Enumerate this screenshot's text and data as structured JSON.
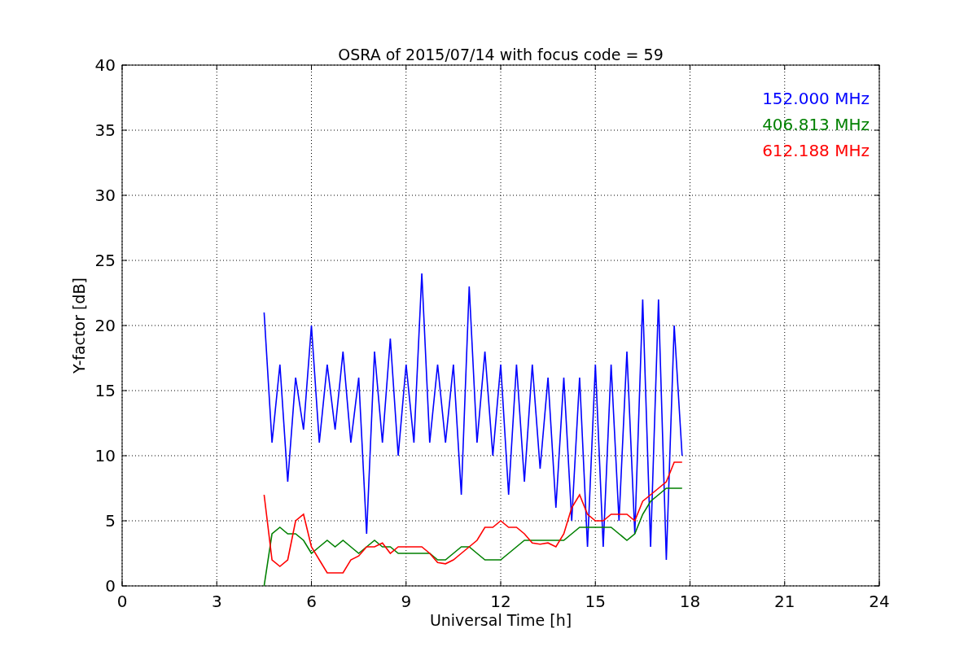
{
  "figure": {
    "chart_data": {
      "type": "line",
      "title": "OSRA of 2015/07/14 with focus code = 59",
      "xlabel": "Universal Time [h]",
      "ylabel": "Y-factor [dB]",
      "x": [
        4.5,
        4.75,
        5,
        5.25,
        5.5,
        5.75,
        6,
        6.25,
        6.5,
        6.75,
        7,
        7.25,
        7.5,
        7.75,
        8,
        8.25,
        8.5,
        8.75,
        9,
        9.25,
        9.5,
        9.75,
        10,
        10.25,
        10.5,
        10.75,
        11,
        11.25,
        11.5,
        11.75,
        12,
        12.25,
        12.5,
        12.75,
        13,
        13.25,
        13.5,
        13.75,
        14,
        14.25,
        14.5,
        14.75,
        15,
        15.25,
        15.5,
        15.75,
        16,
        16.25,
        16.5,
        16.75,
        17,
        17.25,
        17.5,
        17.75
      ],
      "series": [
        {
          "name": "152.000 MHz",
          "color": "#0000ff",
          "values": [
            21,
            11,
            17,
            8,
            16,
            12,
            20,
            11,
            17,
            12,
            18,
            11,
            16,
            4,
            18,
            11,
            19,
            10,
            17,
            11,
            24,
            11,
            17,
            11,
            17,
            7,
            23,
            11,
            18,
            10,
            17,
            7,
            17,
            8,
            17,
            9,
            16,
            6,
            16,
            5,
            16,
            3,
            17,
            3,
            17,
            5,
            18,
            4,
            22,
            3,
            22,
            2,
            20,
            10
          ]
        },
        {
          "name": "406.813 MHz",
          "color": "#008000",
          "values": [
            0,
            4,
            4.5,
            4,
            4,
            3.5,
            2.5,
            3,
            3.5,
            3,
            3.5,
            3,
            2.5,
            3,
            3.5,
            3,
            3,
            2.5,
            2.5,
            2.5,
            2.5,
            2.5,
            2,
            2,
            2.5,
            3,
            3,
            2.5,
            2,
            2,
            2,
            2.5,
            3,
            3.5,
            3.5,
            3.5,
            3.5,
            3.5,
            3.5,
            4,
            4.5,
            4.5,
            4.5,
            4.5,
            4.5,
            4,
            3.5,
            4,
            5.5,
            6.5,
            7,
            7.5,
            7.5,
            7.5
          ]
        },
        {
          "name": "612.188 MHz",
          "color": "#ff0000",
          "values": [
            7,
            2,
            1.5,
            2,
            5,
            5.5,
            3,
            2,
            1,
            1,
            1,
            2,
            2.3,
            3,
            3,
            3.3,
            2.5,
            3,
            3,
            3,
            3,
            2.5,
            1.8,
            1.7,
            2,
            2.5,
            3,
            3.5,
            4.5,
            4.5,
            5,
            4.5,
            4.5,
            4,
            3.3,
            3.2,
            3.3,
            3,
            4,
            6,
            7,
            5.5,
            5,
            5,
            5.5,
            5.5,
            5.5,
            5,
            6.5,
            7,
            7.5,
            8,
            9.5,
            9.5
          ]
        }
      ],
      "grid": true,
      "xlim": [
        0,
        24
      ],
      "ylim": [
        0,
        40
      ],
      "xticks": [
        0,
        3,
        6,
        9,
        12,
        15,
        18,
        21,
        24
      ],
      "yticks": [
        0,
        5,
        10,
        15,
        20,
        25,
        30,
        35,
        40
      ]
    }
  }
}
